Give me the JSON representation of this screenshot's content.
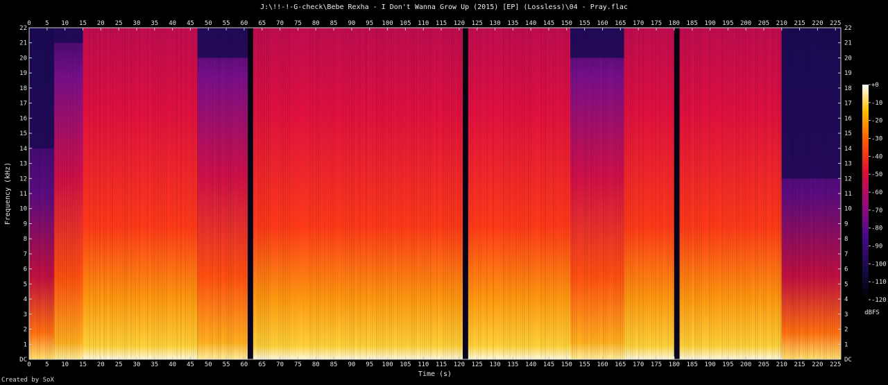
{
  "title": "J:\\!!-!-G-check\\Bebe Rexha - I Don't Wanna Grow Up (2015) [EP] (Lossless)\\04 - Pray.flac",
  "credit": "Created by SoX",
  "chart_data": {
    "type": "heatmap",
    "title": "J:\\!!-!-G-check\\Bebe Rexha - I Don't Wanna Grow Up (2015) [EP] (Lossless)\\04 - Pray.flac",
    "xlabel": "Time (s)",
    "ylabel": "Frequency (kHz)",
    "xlim": [
      0,
      226.5
    ],
    "ylim": [
      0,
      22
    ],
    "x_ticks": [
      0,
      5,
      10,
      15,
      20,
      25,
      30,
      35,
      40,
      45,
      50,
      55,
      60,
      65,
      70,
      75,
      80,
      85,
      90,
      95,
      100,
      105,
      110,
      115,
      120,
      125,
      130,
      135,
      140,
      145,
      150,
      155,
      160,
      165,
      170,
      175,
      180,
      185,
      190,
      195,
      200,
      205,
      210,
      215,
      220,
      225
    ],
    "y_ticks": [
      0,
      1,
      2,
      3,
      4,
      5,
      6,
      7,
      8,
      9,
      10,
      11,
      12,
      13,
      14,
      15,
      16,
      17,
      18,
      19,
      20,
      21,
      22
    ],
    "y_tick_labels": [
      "DC",
      "1",
      "2",
      "3",
      "4",
      "5",
      "6",
      "7",
      "8",
      "9",
      "10",
      "11",
      "12",
      "13",
      "14",
      "15",
      "16",
      "17",
      "18",
      "19",
      "20",
      "21",
      "22"
    ],
    "colorbar": {
      "label": "dBFS",
      "range": [
        -120,
        0
      ],
      "ticks": [
        0,
        -10,
        -20,
        -30,
        -40,
        -50,
        -60,
        -70,
        -80,
        -90,
        -100,
        -110,
        -120
      ],
      "tick_labels": [
        "+0",
        "-10",
        "-20",
        "-30",
        "-40",
        "-50",
        "-60",
        "-70",
        "-80",
        "-90",
        "-100",
        "-110",
        "-120"
      ]
    },
    "segments": [
      {
        "start": 0,
        "end": 7,
        "energy": "quiet",
        "cutoff_khz": 14
      },
      {
        "start": 7,
        "end": 15,
        "energy": "medium",
        "cutoff_khz": 21
      },
      {
        "start": 15,
        "end": 47,
        "energy": "loud",
        "cutoff_khz": 22
      },
      {
        "start": 47,
        "end": 61,
        "energy": "medium",
        "cutoff_khz": 20
      },
      {
        "start": 61,
        "end": 62.5,
        "energy": "silent",
        "cutoff_khz": 0
      },
      {
        "start": 62.5,
        "end": 121,
        "energy": "loud",
        "cutoff_khz": 22
      },
      {
        "start": 121,
        "end": 122.5,
        "energy": "silent",
        "cutoff_khz": 0
      },
      {
        "start": 122.5,
        "end": 151,
        "energy": "loud",
        "cutoff_khz": 22
      },
      {
        "start": 151,
        "end": 166,
        "energy": "medium",
        "cutoff_khz": 20
      },
      {
        "start": 166,
        "end": 180,
        "energy": "loud",
        "cutoff_khz": 22
      },
      {
        "start": 180,
        "end": 181.5,
        "energy": "silent",
        "cutoff_khz": 0
      },
      {
        "start": 181.5,
        "end": 210,
        "energy": "loud",
        "cutoff_khz": 22
      },
      {
        "start": 210,
        "end": 226.5,
        "energy": "quiet",
        "cutoff_khz": 12
      }
    ]
  }
}
